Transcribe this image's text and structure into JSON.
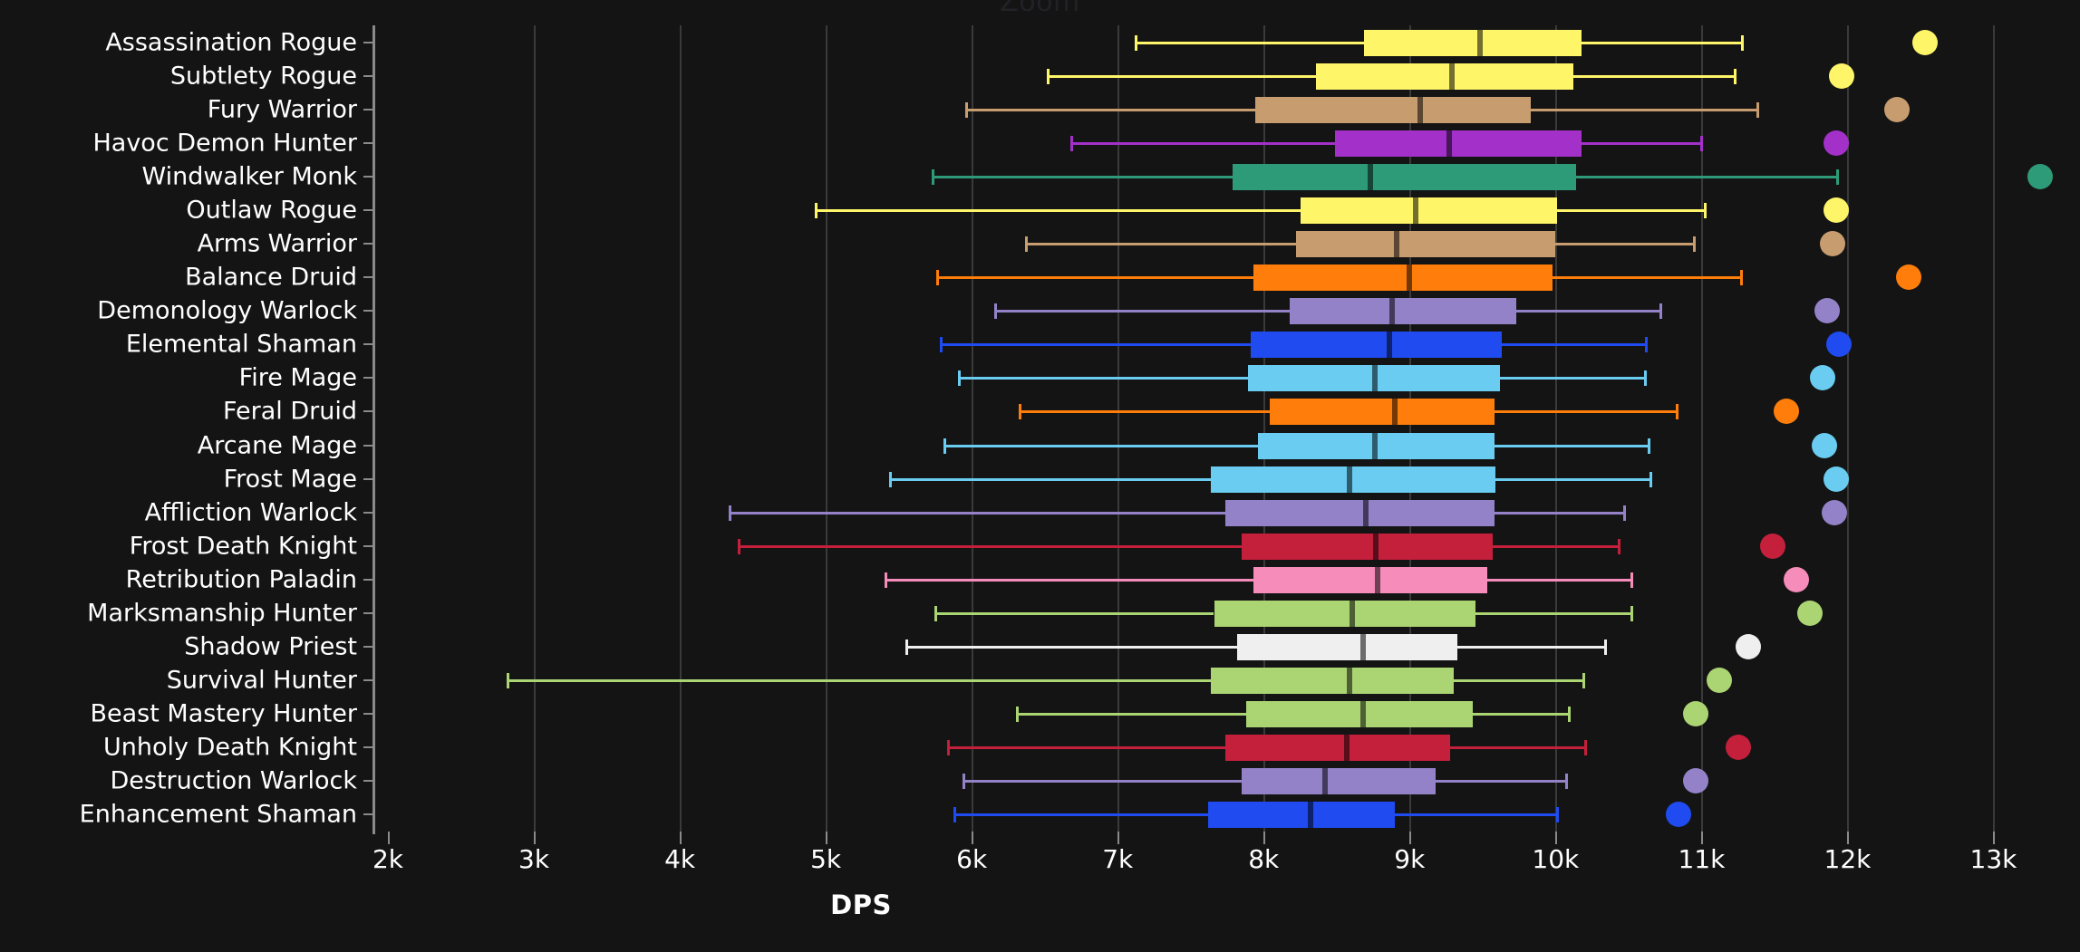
{
  "header": {
    "cutoff_title": "Zoom"
  },
  "axis": {
    "x_title": "DPS",
    "x_ticks": [
      {
        "label": "2k",
        "value": 2000
      },
      {
        "label": "3k",
        "value": 3000
      },
      {
        "label": "4k",
        "value": 4000
      },
      {
        "label": "5k",
        "value": 5000
      },
      {
        "label": "6k",
        "value": 6000
      },
      {
        "label": "7k",
        "value": 7000
      },
      {
        "label": "8k",
        "value": 8000
      },
      {
        "label": "9k",
        "value": 9000
      },
      {
        "label": "10k",
        "value": 10000
      },
      {
        "label": "11k",
        "value": 11000
      },
      {
        "label": "12k",
        "value": 12000
      },
      {
        "label": "13k",
        "value": 13000
      }
    ]
  },
  "class_colors": {
    "rogue": "#FFF569",
    "warrior": "#C79C6E",
    "demon_hunter": "#A330C9",
    "monk": "#2E9B78",
    "druid": "#FF7D0A",
    "warlock": "#9482C9",
    "shaman": "#1F4BF0",
    "mage": "#69CCF0",
    "death_knight": "#C41F3B",
    "paladin": "#F58CBA",
    "hunter": "#ABD473",
    "priest": "#EFEFEF"
  },
  "chart_data": {
    "type": "boxplot",
    "title": "",
    "xlabel": "DPS",
    "ylabel": "",
    "xlim": [
      2000,
      13500
    ],
    "grid": true,
    "orientation": "horizontal",
    "legend": "none",
    "categories": [
      "Assassination Rogue",
      "Subtlety Rogue",
      "Fury Warrior",
      "Havoc Demon Hunter",
      "Windwalker Monk",
      "Outlaw Rogue",
      "Arms Warrior",
      "Balance Druid",
      "Demonology Warlock",
      "Elemental Shaman",
      "Fire Mage",
      "Feral Druid",
      "Arcane Mage",
      "Frost Mage",
      "Affliction Warlock",
      "Frost Death Knight",
      "Retribution Paladin",
      "Marksmanship Hunter",
      "Shadow Priest",
      "Survival Hunter",
      "Beast Mastery Hunter",
      "Unholy Death Knight",
      "Destruction Warlock",
      "Enhancement Shaman"
    ],
    "boxes": [
      {
        "label": "Assassination Rogue",
        "color": "#FFF569",
        "min": 7120,
        "q1": 8690,
        "median": 9480,
        "q3": 10180,
        "max": 11280,
        "outlier": 12530
      },
      {
        "label": "Subtlety Rogue",
        "color": "#FFF569",
        "min": 6520,
        "q1": 8360,
        "median": 9290,
        "q3": 10120,
        "max": 11230,
        "outlier": 11960
      },
      {
        "label": "Fury Warrior",
        "color": "#C79C6E",
        "min": 5960,
        "q1": 7940,
        "median": 9070,
        "q3": 9830,
        "max": 11380,
        "outlier": 12340
      },
      {
        "label": "Havoc Demon Hunter",
        "color": "#A330C9",
        "min": 6680,
        "q1": 8490,
        "median": 9270,
        "q3": 10180,
        "max": 11000,
        "outlier": 11920
      },
      {
        "label": "Windwalker Monk",
        "color": "#2E9B78",
        "min": 5730,
        "q1": 7790,
        "median": 8730,
        "q3": 10140,
        "max": 11930,
        "outlier": 13320
      },
      {
        "label": "Outlaw Rogue",
        "color": "#FFF569",
        "min": 4930,
        "q1": 8250,
        "median": 9040,
        "q3": 10010,
        "max": 11020,
        "outlier": 11920
      },
      {
        "label": "Arms Warrior",
        "color": "#C79C6E",
        "min": 6370,
        "q1": 8220,
        "median": 8910,
        "q3": 10000,
        "max": 10950,
        "outlier": 11900
      },
      {
        "label": "Balance Druid",
        "color": "#FF7D0A",
        "min": 5760,
        "q1": 7930,
        "median": 9000,
        "q3": 9980,
        "max": 11270,
        "outlier": 12420
      },
      {
        "label": "Demonology Warlock",
        "color": "#9482C9",
        "min": 6160,
        "q1": 8180,
        "median": 8880,
        "q3": 9730,
        "max": 10720,
        "outlier": 11860
      },
      {
        "label": "Elemental Shaman",
        "color": "#1F4BF0",
        "min": 5790,
        "q1": 7910,
        "median": 8860,
        "q3": 9630,
        "max": 10620,
        "outlier": 11940
      },
      {
        "label": "Fire Mage",
        "color": "#69CCF0",
        "min": 5910,
        "q1": 7890,
        "median": 8760,
        "q3": 9620,
        "max": 10610,
        "outlier": 11830
      },
      {
        "label": "Feral Druid",
        "color": "#FF7D0A",
        "min": 6330,
        "q1": 8040,
        "median": 8900,
        "q3": 9580,
        "max": 10830,
        "outlier": 11580
      },
      {
        "label": "Arcane Mage",
        "color": "#69CCF0",
        "min": 5810,
        "q1": 7960,
        "median": 8760,
        "q3": 9580,
        "max": 10640,
        "outlier": 11840
      },
      {
        "label": "Frost Mage",
        "color": "#69CCF0",
        "min": 5440,
        "q1": 7640,
        "median": 8590,
        "q3": 9590,
        "max": 10650,
        "outlier": 11920
      },
      {
        "label": "Affliction Warlock",
        "color": "#9482C9",
        "min": 4340,
        "q1": 7740,
        "median": 8700,
        "q3": 9580,
        "max": 10470,
        "outlier": 11910
      },
      {
        "label": "Frost Death Knight",
        "color": "#C41F3B",
        "min": 4400,
        "q1": 7850,
        "median": 8770,
        "q3": 9570,
        "max": 10430,
        "outlier": 11490
      },
      {
        "label": "Retribution Paladin",
        "color": "#F58CBA",
        "min": 5410,
        "q1": 7930,
        "median": 8780,
        "q3": 9530,
        "max": 10520,
        "outlier": 11650
      },
      {
        "label": "Marksmanship Hunter",
        "color": "#ABD473",
        "min": 5750,
        "q1": 7660,
        "median": 8610,
        "q3": 9450,
        "max": 10520,
        "outlier": 11740
      },
      {
        "label": "Shadow Priest",
        "color": "#EFEFEF",
        "min": 5550,
        "q1": 7820,
        "median": 8680,
        "q3": 9330,
        "max": 10340,
        "outlier": 11320
      },
      {
        "label": "Survival Hunter",
        "color": "#ABD473",
        "min": 2820,
        "q1": 7640,
        "median": 8590,
        "q3": 9300,
        "max": 10190,
        "outlier": 11120
      },
      {
        "label": "Beast Mastery Hunter",
        "color": "#ABD473",
        "min": 6310,
        "q1": 7880,
        "median": 8680,
        "q3": 9430,
        "max": 10090,
        "outlier": 10960
      },
      {
        "label": "Unholy Death Knight",
        "color": "#C41F3B",
        "min": 5840,
        "q1": 7740,
        "median": 8570,
        "q3": 9280,
        "max": 10200,
        "outlier": 11250
      },
      {
        "label": "Destruction Warlock",
        "color": "#9482C9",
        "min": 5940,
        "q1": 7850,
        "median": 8420,
        "q3": 9180,
        "max": 10070,
        "outlier": 10960
      },
      {
        "label": "Enhancement Shaman",
        "color": "#1F4BF0",
        "min": 5880,
        "q1": 7620,
        "median": 8320,
        "q3": 8900,
        "max": 10010,
        "outlier": 10840
      }
    ]
  }
}
